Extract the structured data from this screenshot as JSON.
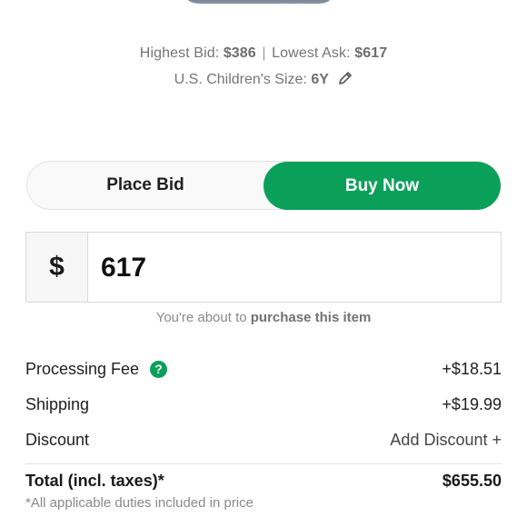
{
  "product": {
    "image_icon": "sneaker-image"
  },
  "market": {
    "highest_bid_label": "Highest Bid:",
    "highest_bid_value": "$386",
    "separator": "|",
    "lowest_ask_label": "Lowest Ask:",
    "lowest_ask_value": "$617"
  },
  "size": {
    "label": "U.S. Children's Size:",
    "value": "6Y",
    "edit_icon": "pencil-icon"
  },
  "mode_toggle": {
    "options": [
      "Place Bid",
      "Buy Now"
    ],
    "selected": "Buy Now",
    "selected_color": "#0ba05a"
  },
  "price_input": {
    "currency_symbol": "$",
    "value": "617"
  },
  "purchase_note": {
    "prefix": "You're about to",
    "emphasis": "purchase this item"
  },
  "fees": {
    "processing": {
      "label": "Processing Fee",
      "help_icon": "?",
      "value": "+$18.51"
    },
    "shipping": {
      "label": "Shipping",
      "value": "+$19.99"
    },
    "discount": {
      "label": "Discount",
      "action": "Add Discount +"
    }
  },
  "total": {
    "label": "Total (incl. taxes)*",
    "value": "$655.50",
    "note": "*All applicable duties included in price"
  }
}
